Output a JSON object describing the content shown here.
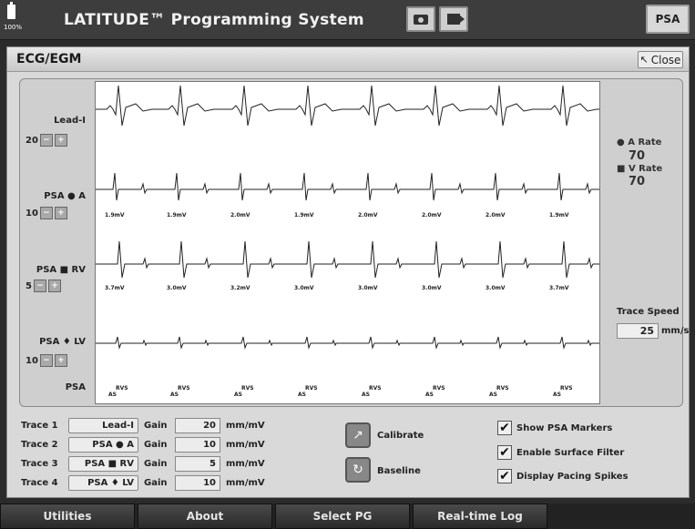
{
  "topbar": {
    "battery_percent": "100%",
    "title": "LATITUDE™ Programming System",
    "psa_button": "PSA"
  },
  "panel": {
    "title": "ECG/EGM",
    "close_label": "Close"
  },
  "traces": [
    {
      "label": "Lead-I",
      "gain": "20"
    },
    {
      "label": "PSA ● A",
      "gain": "10"
    },
    {
      "label": "PSA ■ RV",
      "gain": "5"
    },
    {
      "label": "PSA ♦ LV",
      "gain": "10"
    }
  ],
  "markers_label": "PSA",
  "amplitudes": {
    "atrial": [
      "1.9mV",
      "1.9mV",
      "2.0mV",
      "1.9mV",
      "2.0mV",
      "2.0mV",
      "2.0mV",
      "1.9mV"
    ],
    "ventricular": [
      "3.7mV",
      "3.0mV",
      "3.2mV",
      "3.0mV",
      "3.0mV",
      "3.0mV",
      "3.0mV",
      "3.7mV"
    ]
  },
  "marker_text": {
    "top": "RVS",
    "bottom": "AS"
  },
  "rates": {
    "a_label": "A Rate",
    "a_value": "70",
    "v_label": "V Rate",
    "v_value": "70"
  },
  "trace_speed": {
    "label": "Trace Speed",
    "value": "25",
    "unit": "mm/s"
  },
  "controls": {
    "rows": [
      {
        "name": "Trace 1",
        "source": "Lead-I",
        "gain_label": "Gain",
        "gain": "20",
        "unit": "mm/mV"
      },
      {
        "name": "Trace 2",
        "source": "PSA ● A",
        "gain_label": "Gain",
        "gain": "10",
        "unit": "mm/mV"
      },
      {
        "name": "Trace 3",
        "source": "PSA ■ RV",
        "gain_label": "Gain",
        "gain": "5",
        "unit": "mm/mV"
      },
      {
        "name": "Trace 4",
        "source": "PSA ♦ LV",
        "gain_label": "Gain",
        "gain": "10",
        "unit": "mm/mV"
      }
    ],
    "calibrate": "Calibrate",
    "baseline": "Baseline",
    "checks": [
      {
        "label": "Show PSA Markers",
        "checked": true
      },
      {
        "label": "Enable Surface Filter",
        "checked": true
      },
      {
        "label": "Display Pacing Spikes",
        "checked": true
      }
    ]
  },
  "bottom_tabs": [
    "Utilities",
    "About",
    "Select PG",
    "Real-time Log"
  ]
}
